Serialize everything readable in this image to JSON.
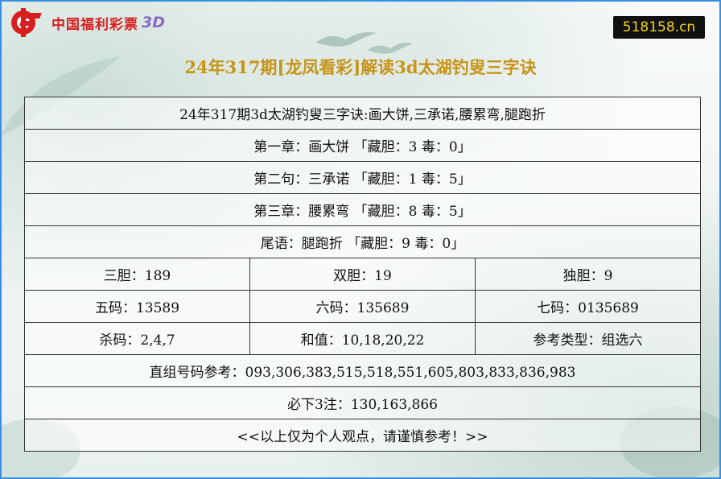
{
  "header": {
    "logo_text": "中国福利彩票",
    "logo_3d": "3D",
    "site": "518158.cn"
  },
  "title": "24年317期[龙凤看彩]解读3d太湖钓叟三字诀",
  "rows": {
    "r1": "24年317期3d太湖钓叟三字诀:画大饼,三承诺,腰累弯,腿跑折",
    "r2": "第一章：画大饼 「藏胆：3 毒：0」",
    "r3": "第二句：三承诺 「藏胆：1 毒：5」",
    "r4": "第三章：腰累弯 「藏胆：8 毒：5」",
    "r5": "尾语：腿跑折 「藏胆：9 毒：0」",
    "r6": [
      "三胆：189",
      "双胆：19",
      "独胆：9"
    ],
    "r7": [
      "五码：13589",
      "六码：135689",
      "七码：0135689"
    ],
    "r8": [
      "杀码：2,4,7",
      "和值：10,18,20,22",
      "参考类型：组选六"
    ],
    "r9": "直组号码参考：093,306,383,515,518,551,605,803,833,836,983",
    "r10": "必下3注：130,163,866",
    "r11": "<<以上仅为个人观点，请谨慎参考！>>"
  },
  "colors": {
    "title": "#c89416",
    "frame": "#3a8fe0",
    "logo_red": "#d81e1e",
    "badge_bg": "#111111",
    "badge_text": "#f2d21b"
  }
}
